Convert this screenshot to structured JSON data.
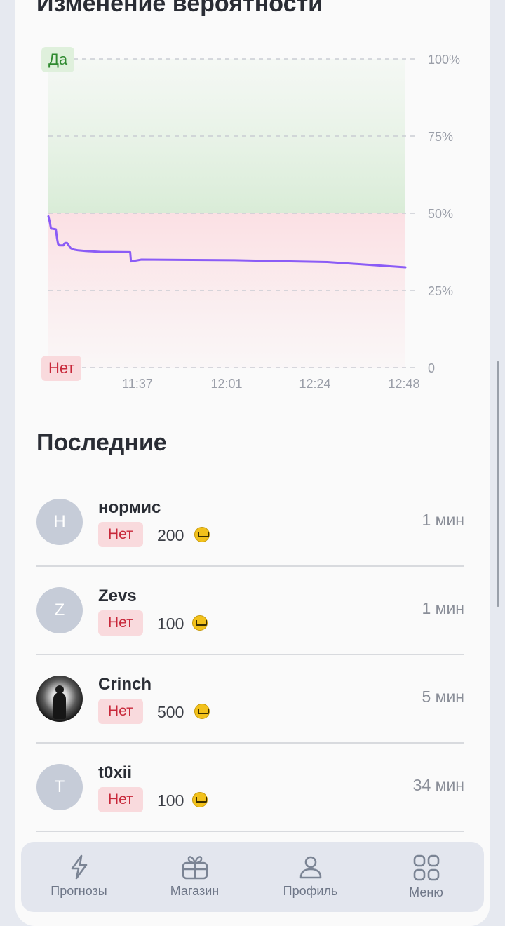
{
  "chart": {
    "title": "Изменение вероятности",
    "tag_yes": "Да",
    "tag_no": "Нет"
  },
  "chart_data": {
    "type": "line",
    "title": "Изменение вероятности",
    "y_tick_labels": [
      "100%",
      "75%",
      "50%",
      "25%",
      "0"
    ],
    "x_tick_labels": [
      "11:37",
      "12:01",
      "12:24",
      "12:48"
    ],
    "ylim": [
      0,
      100
    ],
    "grid": true,
    "series": [
      {
        "color": "#8b5cf6",
        "points_minutes_from_start": [
          0,
          0.4,
          0.7,
          1.0,
          2.0,
          2.3,
          2.6,
          3.0,
          4.0,
          4.5,
          5.0,
          6.0,
          6.5,
          7.0,
          8.0,
          10.0,
          14.0,
          22.0,
          22.2,
          25.0,
          50.0,
          75.0,
          96.0
        ],
        "points_y": [
          49,
          47,
          45,
          45,
          44.8,
          42,
          40,
          39.6,
          39.6,
          40.4,
          40.4,
          38.7,
          38.4,
          38.2,
          38.0,
          37.8,
          37.5,
          37.4,
          34.4,
          35.0,
          34.8,
          34.2,
          32.5
        ]
      }
    ],
    "zones": [
      {
        "label": "Да",
        "from": 50,
        "to": 100,
        "color": "#e3f1e2"
      },
      {
        "label": "Нет",
        "from": 0,
        "to": 50,
        "color": "#fbe3e6"
      }
    ]
  },
  "recent": {
    "title": "Последние",
    "items": [
      {
        "name": "нормис",
        "initial": "Н",
        "side": "Нет",
        "amount": "200",
        "time": "1 мин",
        "photo": false
      },
      {
        "name": "Zevs",
        "initial": "Z",
        "side": "Нет",
        "amount": "100",
        "time": "1 мин",
        "photo": false
      },
      {
        "name": "Crinch",
        "initial": "",
        "side": "Нет",
        "amount": "500",
        "time": "5 мин",
        "photo": true
      },
      {
        "name": "t0xii",
        "initial": "T",
        "side": "Нет",
        "amount": "100",
        "time": "34 мин",
        "photo": false
      }
    ]
  },
  "nav": {
    "items": [
      {
        "label": "Прогнозы",
        "icon": "lightning-icon"
      },
      {
        "label": "Магазин",
        "icon": "gift-icon"
      },
      {
        "label": "Профиль",
        "icon": "user-icon"
      },
      {
        "label": "Меню",
        "icon": "grid-icon"
      }
    ]
  },
  "colors": {
    "accent_line": "#8b5cf6",
    "yes": "#2f8a30",
    "no": "#c8283a"
  }
}
